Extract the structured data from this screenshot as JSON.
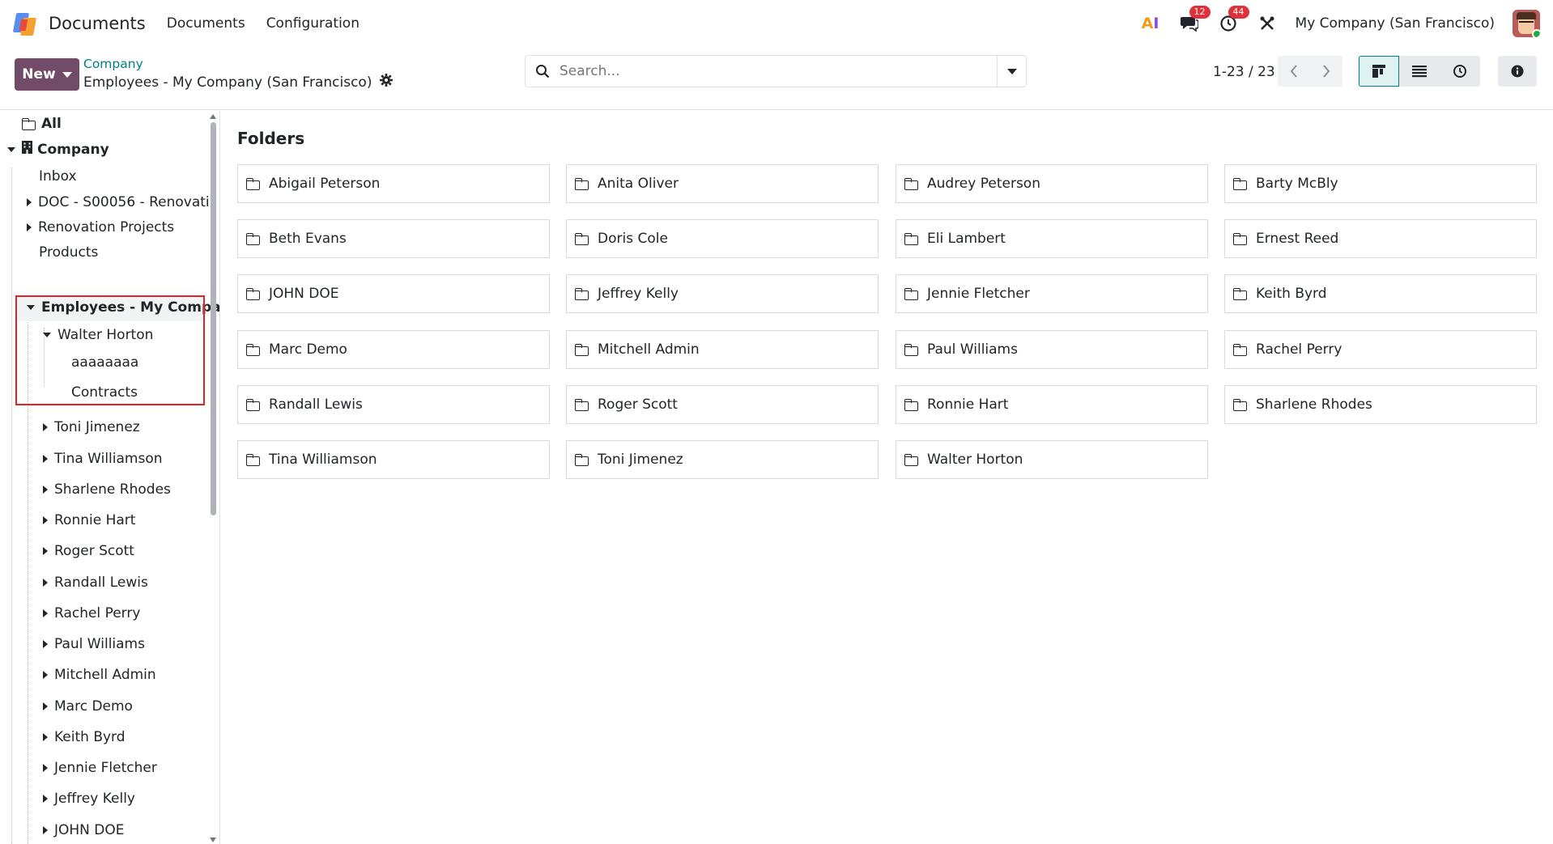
{
  "navbar": {
    "app_name": "Documents",
    "menu": [
      "Documents",
      "Configuration"
    ],
    "ai_label": "AI",
    "messages_count": "12",
    "activities_count": "44",
    "company": "My Company (San Francisco)"
  },
  "control": {
    "new_label": "New",
    "breadcrumb_parent": "Company",
    "breadcrumb_current": "Employees - My Company (San Francisco)",
    "search_placeholder": "Search...",
    "pager": "1-23 / 23"
  },
  "sidebar": {
    "all": "All",
    "company": "Company",
    "inbox": "Inbox",
    "doc": "DOC - S00056 - Renovati",
    "renovation": "Renovation Projects",
    "products": "Products",
    "employees": "Employees - My Compa.",
    "walter": "Walter Horton",
    "sub1": "aaaaaaaa",
    "sub2": "Contracts",
    "employees_list": [
      "Toni Jimenez",
      "Tina Williamson",
      "Sharlene Rhodes",
      "Ronnie Hart",
      "Roger Scott",
      "Randall Lewis",
      "Rachel Perry",
      "Paul Williams",
      "Mitchell Admin",
      "Marc Demo",
      "Keith Byrd",
      "Jennie Fletcher",
      "Jeffrey Kelly",
      "JOHN DOE"
    ]
  },
  "main": {
    "section_title": "Folders",
    "folders": [
      "Abigail Peterson",
      "Anita Oliver",
      "Audrey Peterson",
      "Barty McBly",
      "Beth Evans",
      "Doris Cole",
      "Eli Lambert",
      "Ernest Reed",
      "JOHN DOE",
      "Jeffrey Kelly",
      "Jennie Fletcher",
      "Keith Byrd",
      "Marc Demo",
      "Mitchell Admin",
      "Paul Williams",
      "Rachel Perry",
      "Randall Lewis",
      "Roger Scott",
      "Ronnie Hart",
      "Sharlene Rhodes",
      "Tina Williamson",
      "Toni Jimenez",
      "Walter Horton"
    ]
  },
  "colors": {
    "primary": "#714b67",
    "link": "#017e84",
    "badge": "#e0313b",
    "highlight": "#e02424"
  }
}
